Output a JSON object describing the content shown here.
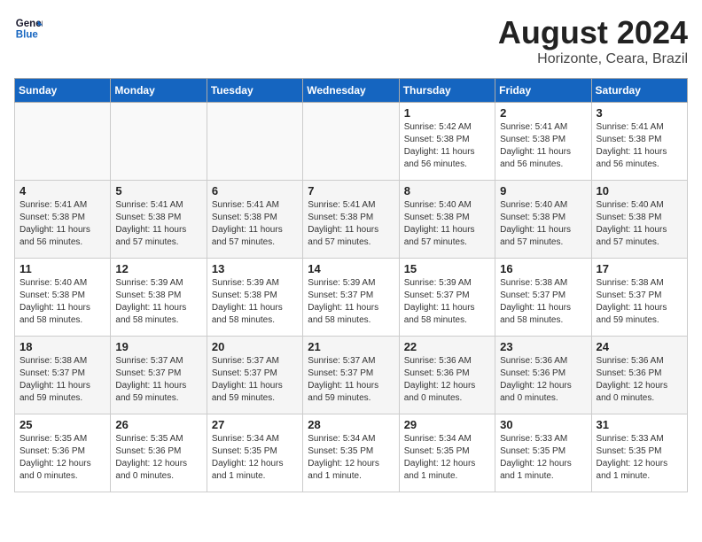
{
  "header": {
    "logo_line1": "General",
    "logo_line2": "Blue",
    "month": "August 2024",
    "location": "Horizonte, Ceara, Brazil"
  },
  "weekdays": [
    "Sunday",
    "Monday",
    "Tuesday",
    "Wednesday",
    "Thursday",
    "Friday",
    "Saturday"
  ],
  "weeks": [
    [
      {
        "day": "",
        "info": ""
      },
      {
        "day": "",
        "info": ""
      },
      {
        "day": "",
        "info": ""
      },
      {
        "day": "",
        "info": ""
      },
      {
        "day": "1",
        "info": "Sunrise: 5:42 AM\nSunset: 5:38 PM\nDaylight: 11 hours\nand 56 minutes."
      },
      {
        "day": "2",
        "info": "Sunrise: 5:41 AM\nSunset: 5:38 PM\nDaylight: 11 hours\nand 56 minutes."
      },
      {
        "day": "3",
        "info": "Sunrise: 5:41 AM\nSunset: 5:38 PM\nDaylight: 11 hours\nand 56 minutes."
      }
    ],
    [
      {
        "day": "4",
        "info": "Sunrise: 5:41 AM\nSunset: 5:38 PM\nDaylight: 11 hours\nand 56 minutes."
      },
      {
        "day": "5",
        "info": "Sunrise: 5:41 AM\nSunset: 5:38 PM\nDaylight: 11 hours\nand 57 minutes."
      },
      {
        "day": "6",
        "info": "Sunrise: 5:41 AM\nSunset: 5:38 PM\nDaylight: 11 hours\nand 57 minutes."
      },
      {
        "day": "7",
        "info": "Sunrise: 5:41 AM\nSunset: 5:38 PM\nDaylight: 11 hours\nand 57 minutes."
      },
      {
        "day": "8",
        "info": "Sunrise: 5:40 AM\nSunset: 5:38 PM\nDaylight: 11 hours\nand 57 minutes."
      },
      {
        "day": "9",
        "info": "Sunrise: 5:40 AM\nSunset: 5:38 PM\nDaylight: 11 hours\nand 57 minutes."
      },
      {
        "day": "10",
        "info": "Sunrise: 5:40 AM\nSunset: 5:38 PM\nDaylight: 11 hours\nand 57 minutes."
      }
    ],
    [
      {
        "day": "11",
        "info": "Sunrise: 5:40 AM\nSunset: 5:38 PM\nDaylight: 11 hours\nand 58 minutes."
      },
      {
        "day": "12",
        "info": "Sunrise: 5:39 AM\nSunset: 5:38 PM\nDaylight: 11 hours\nand 58 minutes."
      },
      {
        "day": "13",
        "info": "Sunrise: 5:39 AM\nSunset: 5:38 PM\nDaylight: 11 hours\nand 58 minutes."
      },
      {
        "day": "14",
        "info": "Sunrise: 5:39 AM\nSunset: 5:37 PM\nDaylight: 11 hours\nand 58 minutes."
      },
      {
        "day": "15",
        "info": "Sunrise: 5:39 AM\nSunset: 5:37 PM\nDaylight: 11 hours\nand 58 minutes."
      },
      {
        "day": "16",
        "info": "Sunrise: 5:38 AM\nSunset: 5:37 PM\nDaylight: 11 hours\nand 58 minutes."
      },
      {
        "day": "17",
        "info": "Sunrise: 5:38 AM\nSunset: 5:37 PM\nDaylight: 11 hours\nand 59 minutes."
      }
    ],
    [
      {
        "day": "18",
        "info": "Sunrise: 5:38 AM\nSunset: 5:37 PM\nDaylight: 11 hours\nand 59 minutes."
      },
      {
        "day": "19",
        "info": "Sunrise: 5:37 AM\nSunset: 5:37 PM\nDaylight: 11 hours\nand 59 minutes."
      },
      {
        "day": "20",
        "info": "Sunrise: 5:37 AM\nSunset: 5:37 PM\nDaylight: 11 hours\nand 59 minutes."
      },
      {
        "day": "21",
        "info": "Sunrise: 5:37 AM\nSunset: 5:37 PM\nDaylight: 11 hours\nand 59 minutes."
      },
      {
        "day": "22",
        "info": "Sunrise: 5:36 AM\nSunset: 5:36 PM\nDaylight: 12 hours\nand 0 minutes."
      },
      {
        "day": "23",
        "info": "Sunrise: 5:36 AM\nSunset: 5:36 PM\nDaylight: 12 hours\nand 0 minutes."
      },
      {
        "day": "24",
        "info": "Sunrise: 5:36 AM\nSunset: 5:36 PM\nDaylight: 12 hours\nand 0 minutes."
      }
    ],
    [
      {
        "day": "25",
        "info": "Sunrise: 5:35 AM\nSunset: 5:36 PM\nDaylight: 12 hours\nand 0 minutes."
      },
      {
        "day": "26",
        "info": "Sunrise: 5:35 AM\nSunset: 5:36 PM\nDaylight: 12 hours\nand 0 minutes."
      },
      {
        "day": "27",
        "info": "Sunrise: 5:34 AM\nSunset: 5:35 PM\nDaylight: 12 hours\nand 1 minute."
      },
      {
        "day": "28",
        "info": "Sunrise: 5:34 AM\nSunset: 5:35 PM\nDaylight: 12 hours\nand 1 minute."
      },
      {
        "day": "29",
        "info": "Sunrise: 5:34 AM\nSunset: 5:35 PM\nDaylight: 12 hours\nand 1 minute."
      },
      {
        "day": "30",
        "info": "Sunrise: 5:33 AM\nSunset: 5:35 PM\nDaylight: 12 hours\nand 1 minute."
      },
      {
        "day": "31",
        "info": "Sunrise: 5:33 AM\nSunset: 5:35 PM\nDaylight: 12 hours\nand 1 minute."
      }
    ]
  ]
}
